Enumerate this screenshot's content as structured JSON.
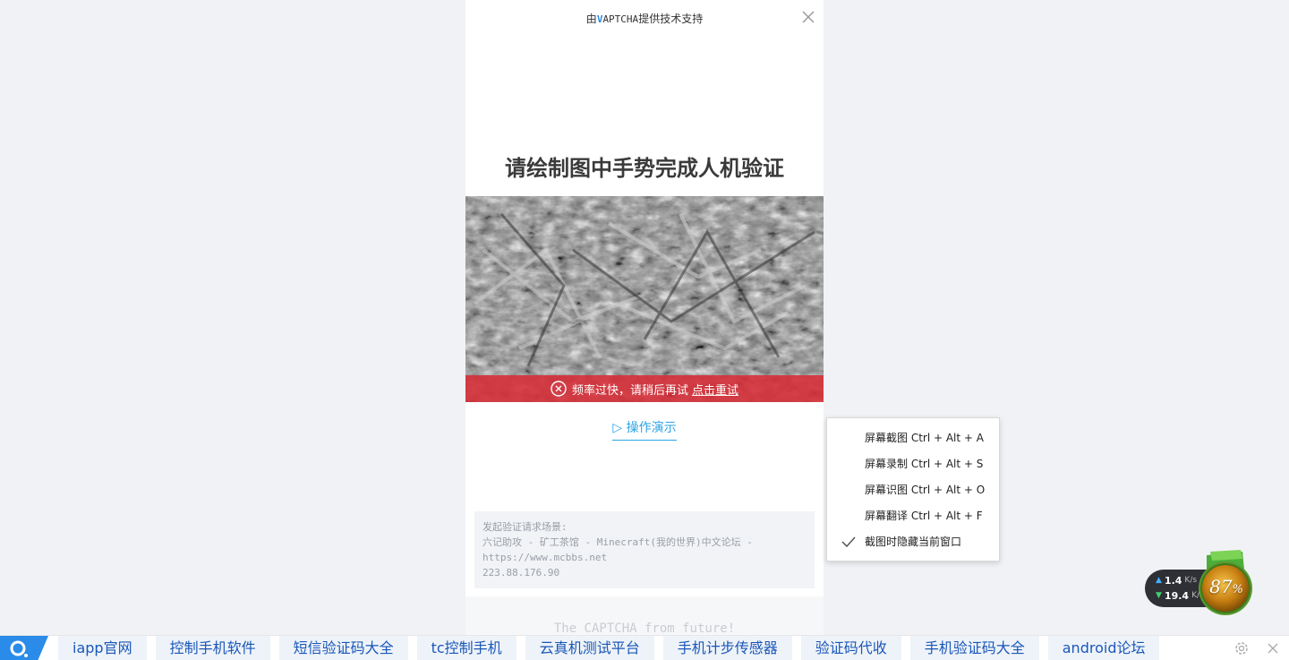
{
  "captcha": {
    "provider_prefix": "由",
    "provider_brand_v": "V",
    "provider_brand_rest": "APTCHA",
    "provider_suffix": "提供技术支持",
    "title": "请绘制图中手势完成人机验证",
    "error_message": "频率过快，请稍后再试",
    "retry_link": "点击重试",
    "demo_link": "▷ 操作演示",
    "scene": {
      "label": "发起验证请求场景:",
      "site": "六记助攻 - 矿工茶馆 - Minecraft(我的世界)中文论坛 -",
      "url": "https://www.mcbbs.net",
      "ip": "223.88.176.90"
    },
    "footer": "The CAPTCHA from future!"
  },
  "context_menu": {
    "items": [
      {
        "label": "屏幕截图 Ctrl + Alt + A",
        "checked": false
      },
      {
        "label": "屏幕录制 Ctrl + Alt + S",
        "checked": false
      },
      {
        "label": "屏幕识图 Ctrl + Alt + O",
        "checked": false
      },
      {
        "label": "屏幕翻译 Ctrl + Alt + F",
        "checked": false
      },
      {
        "label": "截图时隐藏当前窗口",
        "checked": true
      }
    ]
  },
  "speed_widget": {
    "upload": "1.4",
    "download": "19.4",
    "unit": "K/s",
    "percent": "87",
    "percent_sign": "%"
  },
  "bottom_bar": {
    "links": [
      "iapp官网",
      "控制手机软件",
      "短信验证码大全",
      "tc控制手机",
      "云真机测试平台",
      "手机计步传感器",
      "验证码代收",
      "手机验证码大全",
      "android论坛"
    ]
  },
  "colors": {
    "accent": "#2ba3e6",
    "error": "#d72d37",
    "link": "#1a57b8"
  },
  "icons": [
    "close-icon",
    "error-circle-icon",
    "check-icon",
    "up-arrow-icon",
    "down-arrow-icon",
    "browser-logo-icon",
    "gear-icon"
  ]
}
